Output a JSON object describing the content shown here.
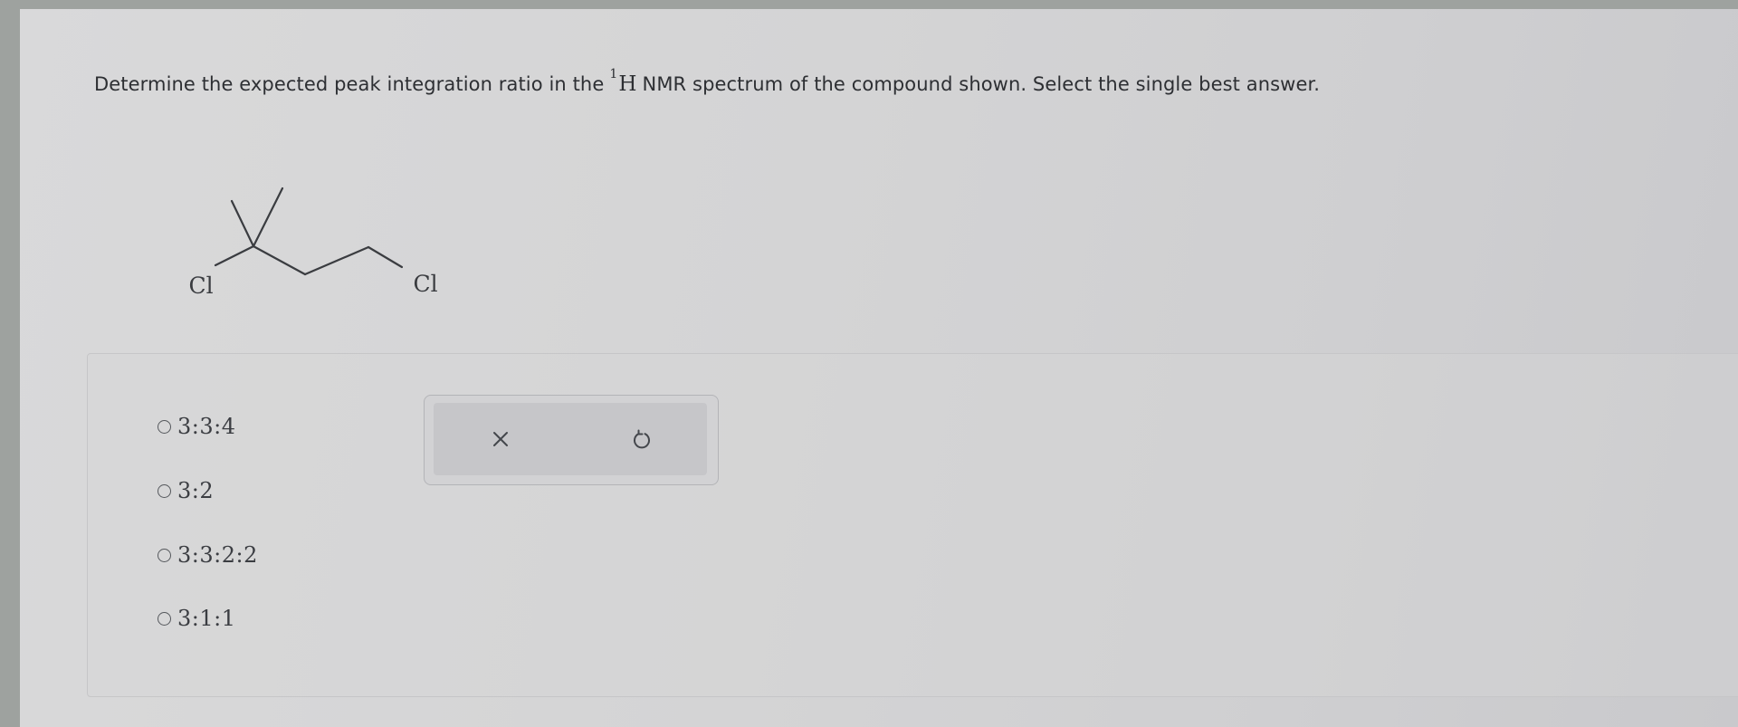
{
  "question": {
    "prefix": "Determine the expected peak integration ratio in the",
    "superscript": "1",
    "nucleus": "H",
    "suffix": "NMR spectrum of the compound shown. Select the single best answer."
  },
  "structure": {
    "atom_left": "Cl",
    "atom_right": "Cl"
  },
  "options": [
    {
      "label": "3:3:4",
      "selected": false
    },
    {
      "label": "3:2",
      "selected": false
    },
    {
      "label": "3:3:2:2",
      "selected": false
    },
    {
      "label": "3:1:1",
      "selected": false
    }
  ],
  "tools": {
    "clear_icon": "x-icon",
    "reset_icon": "undo-icon"
  }
}
